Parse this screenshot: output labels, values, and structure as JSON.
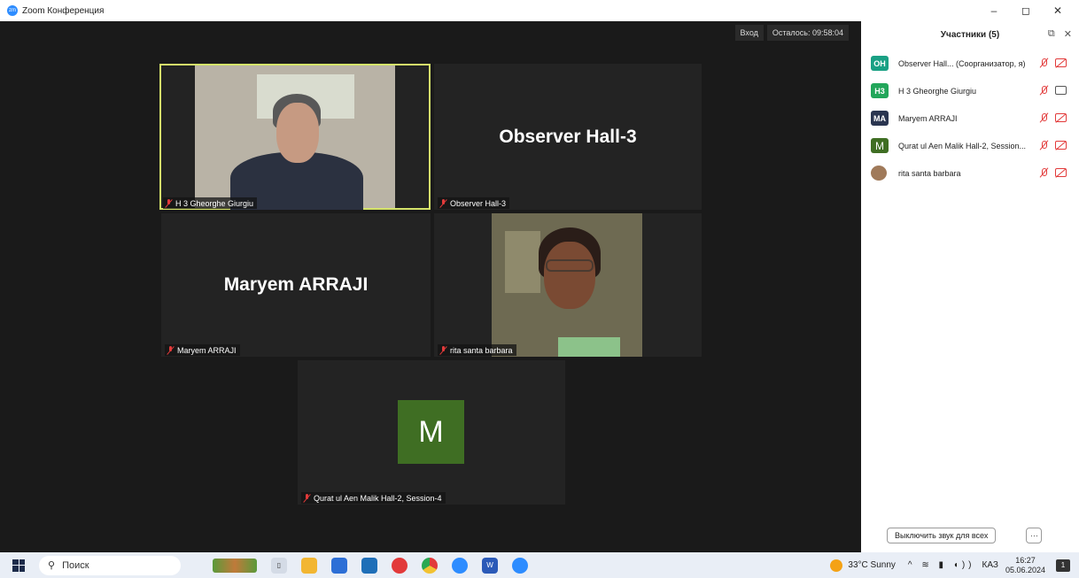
{
  "window": {
    "title": "Zoom Конференция",
    "controls": [
      "–",
      "◻",
      "✕"
    ]
  },
  "meeting": {
    "enter_label": "Вход",
    "time_left": "Осталось: 09:58:04"
  },
  "tiles": {
    "t1": {
      "label": "H 3 Gheorghe Giurgiu"
    },
    "t2": {
      "big_name": "Observer Hall-3",
      "label": "Observer Hall-3"
    },
    "t3": {
      "big_name": "Maryem ARRAJI",
      "label": "Maryem ARRAJI"
    },
    "t4": {
      "label": "rita santa barbara"
    },
    "t5": {
      "avatar_letter": "M",
      "label": "Qurat ul Aen Malik Hall-2, Session-4"
    }
  },
  "panel": {
    "title": "Участники (5)",
    "participants": [
      {
        "initials": "OH",
        "color": "#1aa084",
        "name": "Observer Hall...  (Соорганизатор, я)",
        "cam": "off"
      },
      {
        "initials": "H3",
        "color": "#22a65a",
        "name": "H 3 Gheorghe Giurgiu",
        "cam": "on"
      },
      {
        "initials": "MA",
        "color": "#2a3550",
        "name": "Maryem ARRAJI",
        "cam": "off"
      },
      {
        "initials": "M",
        "color": "#3f6e23",
        "name": "Qurat ul Aen Malik Hall-2, Session...",
        "cam": "off"
      },
      {
        "initials": "",
        "color": "#a07a5a",
        "name": "rita santa barbara",
        "cam": "off"
      }
    ],
    "mute_all": "Выключить звук для всех",
    "more": "···"
  },
  "taskbar": {
    "search": "Поиск",
    "weather": "33°C  Sunny",
    "lang": "КАЗ",
    "time": "16:27",
    "date": "05.06.2024",
    "notifications": "1"
  }
}
